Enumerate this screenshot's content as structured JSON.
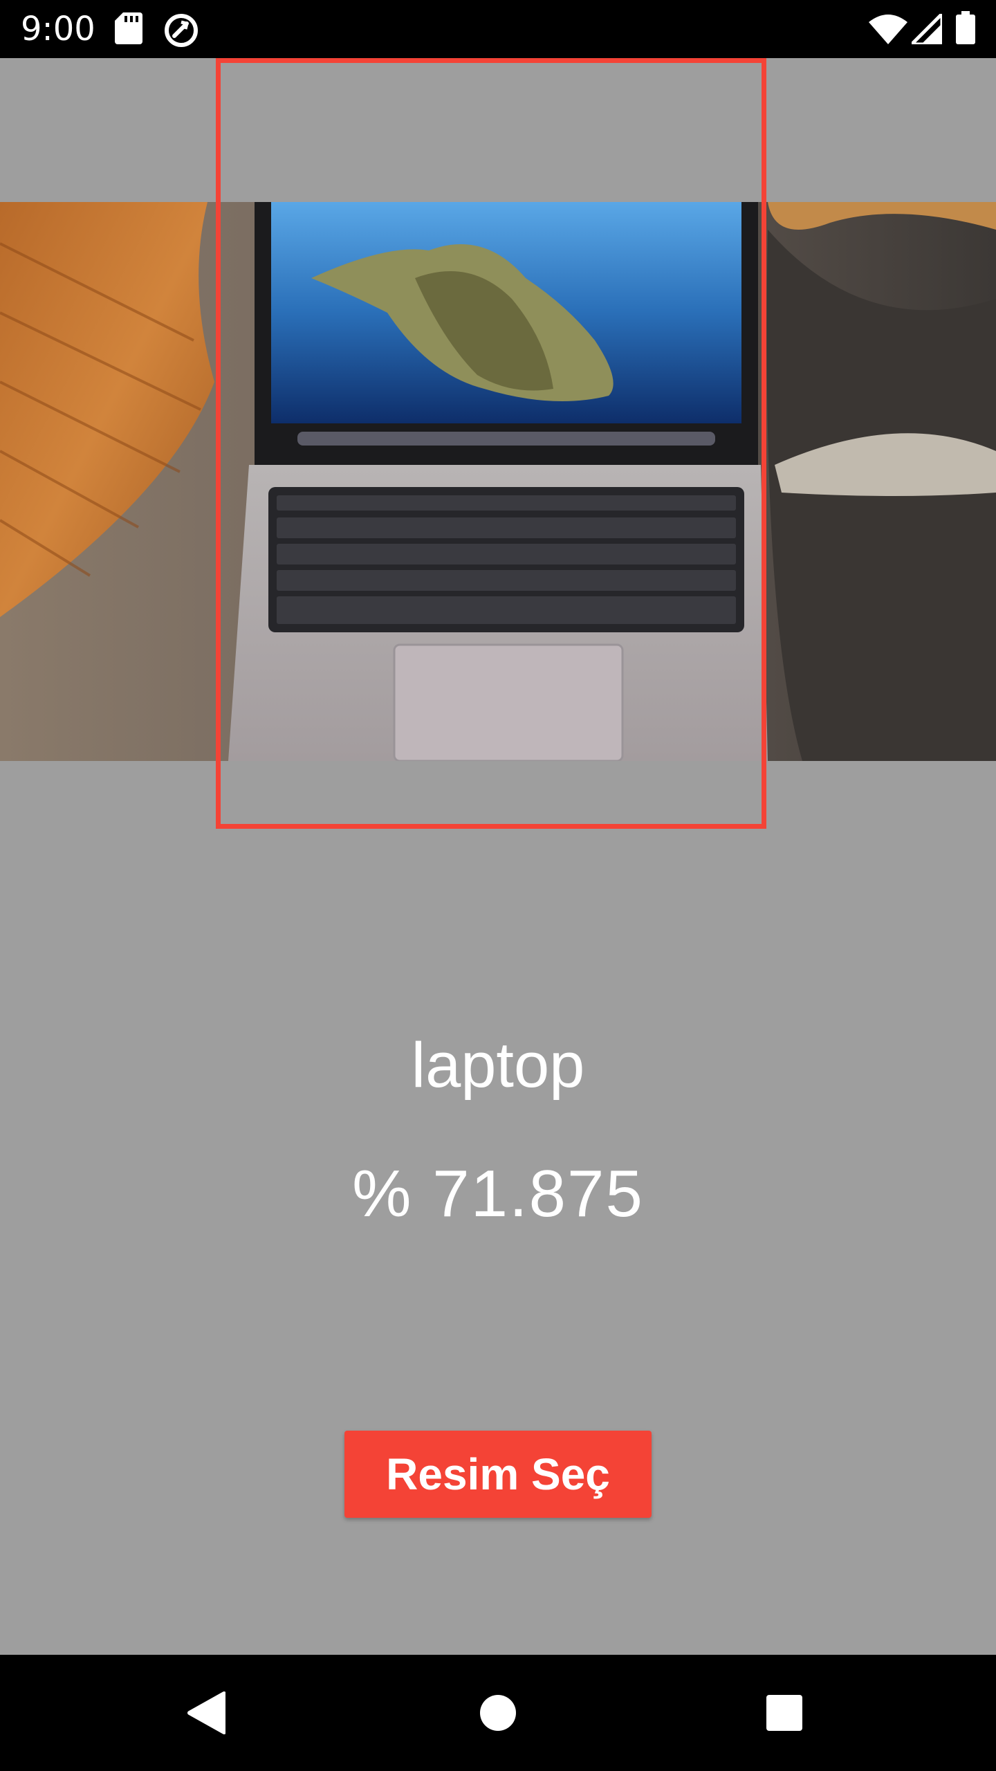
{
  "status_bar": {
    "time": "9:00",
    "icons": [
      "sd-card-icon",
      "sync-disabled-icon",
      "wifi-icon",
      "signal-icon",
      "battery-icon"
    ]
  },
  "photo": {
    "description_icon": "laptop-photo"
  },
  "detection": {
    "label": "laptop",
    "confidence": "% 71.875",
    "box_color": "#f44336"
  },
  "actions": {
    "pick_image_label": "Resim Seç"
  },
  "colors": {
    "background": "#9e9e9e",
    "accent": "#f44336",
    "bars": "#000000"
  },
  "nav_bar": {
    "buttons": [
      "back-icon",
      "home-icon",
      "recents-icon"
    ]
  }
}
